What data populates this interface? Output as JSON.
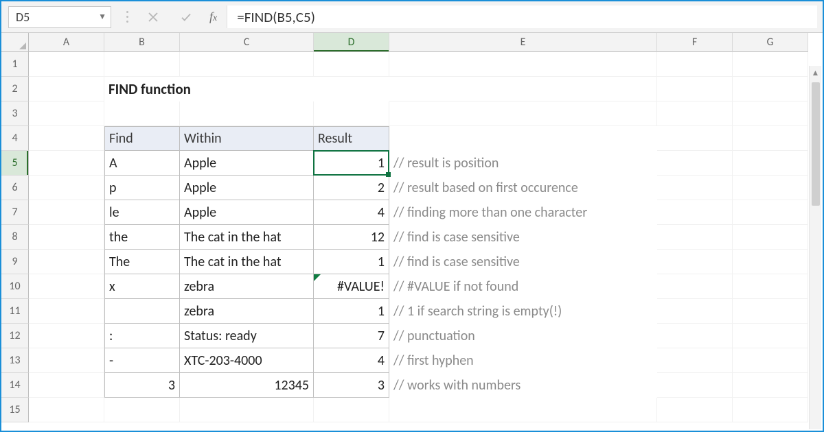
{
  "namebox": {
    "value": "D5"
  },
  "formula_bar": {
    "value": "=FIND(B5,C5)"
  },
  "columns": [
    "A",
    "B",
    "C",
    "D",
    "E",
    "F",
    "G"
  ],
  "title": "FIND function",
  "table": {
    "headers": {
      "find": "Find",
      "within": "Within",
      "result": "Result"
    },
    "rows": [
      {
        "find": "A",
        "within": "Apple",
        "result": "1",
        "comment": "// result is position"
      },
      {
        "find": "p",
        "within": "Apple",
        "result": "2",
        "comment": "// result based on first occurence"
      },
      {
        "find": "le",
        "within": "Apple",
        "result": "4",
        "comment": "// finding more than one character"
      },
      {
        "find": "the",
        "within": "The cat in the hat",
        "result": "12",
        "comment": "// find is case sensitive"
      },
      {
        "find": "The",
        "within": "The cat in the hat",
        "result": "1",
        "comment": "// find is case sensitive"
      },
      {
        "find": "x",
        "within": "zebra",
        "result": "#VALUE!",
        "comment": "// #VALUE if not found"
      },
      {
        "find": "",
        "within": "zebra",
        "result": "1",
        "comment": "// 1 if search string is empty(!)"
      },
      {
        "find": ":",
        "within": "Status: ready",
        "result": "7",
        "comment": "// punctuation"
      },
      {
        "find": "-",
        "within": "XTC-203-4000",
        "result": "4",
        "comment": "// first hyphen"
      },
      {
        "find": "3",
        "within": "12345",
        "result": "3",
        "comment": "// works with numbers",
        "find_numeric": true,
        "within_numeric": true
      }
    ]
  },
  "selection": {
    "cell": "D5",
    "row": 5,
    "col": "D"
  }
}
